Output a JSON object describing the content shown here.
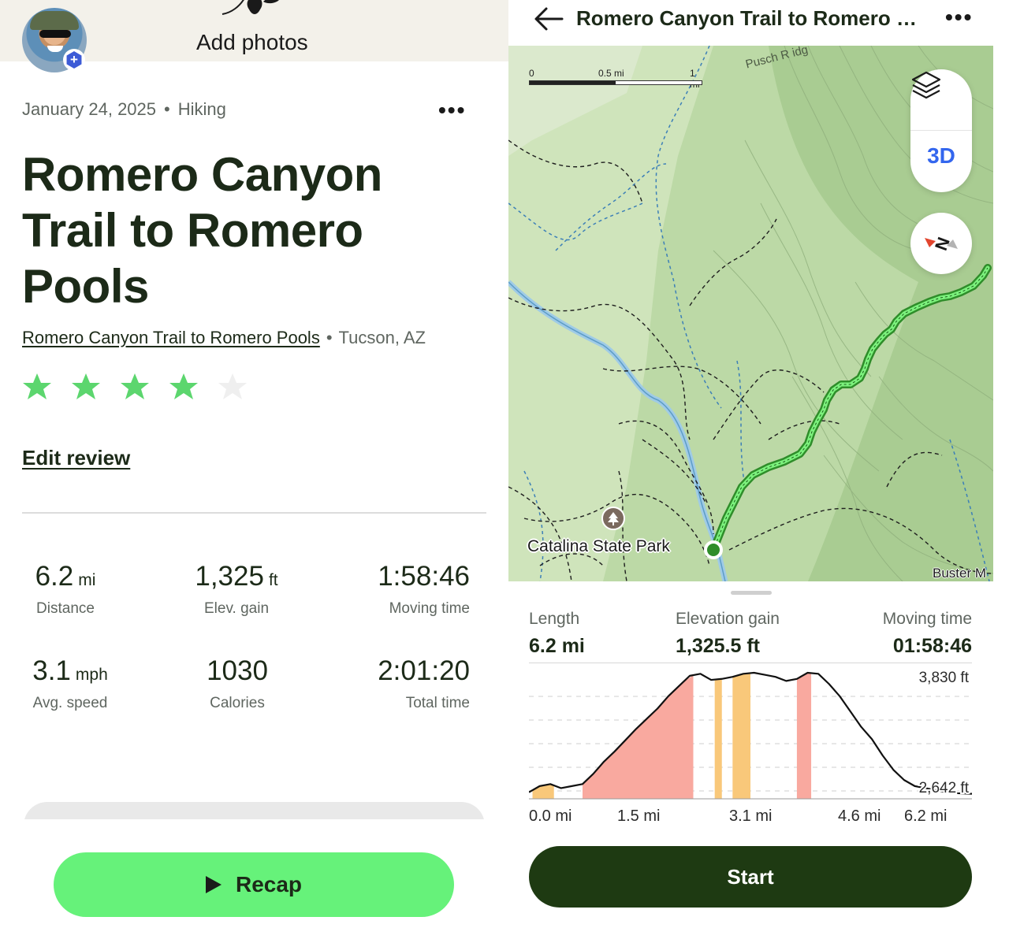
{
  "left": {
    "add_photos_label": "Add photos",
    "activity": {
      "date": "January 24, 2025",
      "separator": "•",
      "type": "Hiking",
      "more_label": "•••"
    },
    "title": "Romero Canyon Trail to Romero Pools",
    "trail": {
      "link_text": "Romero Canyon Trail to Romero Pools",
      "separator": "•",
      "location": "Tucson, AZ"
    },
    "rating": {
      "value": 4,
      "max": 5
    },
    "edit_review_label": "Edit review",
    "stats": [
      {
        "value": "6.2",
        "unit": "mi",
        "label": "Distance"
      },
      {
        "value": "1,325",
        "unit": "ft",
        "label": "Elev. gain"
      },
      {
        "value": "1:58:46",
        "unit": "",
        "label": "Moving time"
      },
      {
        "value": "3.1",
        "unit": "mph",
        "label": "Avg. speed"
      },
      {
        "value": "1030",
        "unit": "",
        "label": "Calories"
      },
      {
        "value": "2:01:20",
        "unit": "",
        "label": "Total time"
      }
    ],
    "recap_label": "Recap"
  },
  "right": {
    "header": {
      "title": "Romero Canyon Trail to Romero P...",
      "more_label": "•••"
    },
    "map": {
      "scale": {
        "zero": "0",
        "half": "0.5 mi",
        "one": "1 mi"
      },
      "toggle_3d_label": "3D",
      "place_label": "Catalina State Park",
      "corner_label": "Buster M",
      "ridge_label": "Pusch R idg"
    },
    "summary": {
      "length_label": "Length",
      "length_value": "6.2 mi",
      "gain_label": "Elevation gain",
      "gain_value": "1,325.5 ft",
      "moving_label": "Moving time",
      "moving_value": "01:58:46"
    },
    "start_label": "Start"
  },
  "colors": {
    "accent_green": "#66f27a",
    "dark_green": "#1e3a12",
    "star_filled": "#5cd66e",
    "star_empty": "#efefef",
    "steep_red": "#f9a99f",
    "moderate_orange": "#f9c87a",
    "map_blue_3d": "#3366ee"
  },
  "icons": [
    "back-arrow-icon",
    "more-icon",
    "layers-icon",
    "compass-icon",
    "park-icon",
    "play-icon",
    "star-icon",
    "add-photo-icon"
  ],
  "chart_data": {
    "type": "area",
    "title": "",
    "xlabel": "",
    "ylabel": "",
    "x_ticks": [
      "0.0 mi",
      "1.5 mi",
      "3.1 mi",
      "4.6 mi",
      "6.2 mi"
    ],
    "y_ticks": [
      "3,830 ft",
      "2,642 ft"
    ],
    "xlim": [
      0,
      6.2
    ],
    "ylim": [
      2642,
      3830
    ],
    "grid": true,
    "series": [
      {
        "x": [
          0.0,
          0.15,
          0.3,
          0.45,
          0.6,
          0.75,
          0.9,
          1.05,
          1.2,
          1.35,
          1.5,
          1.65,
          1.8,
          1.95,
          2.1,
          2.25,
          2.4,
          2.55,
          2.7,
          2.85,
          3.0,
          3.15,
          3.3,
          3.45,
          3.6,
          3.75,
          3.9,
          4.05,
          4.2,
          4.35,
          4.5,
          4.65,
          4.8,
          4.95,
          5.1,
          5.25,
          5.4,
          5.55,
          5.7,
          5.85,
          6.0,
          6.2
        ],
        "values": [
          2660,
          2720,
          2740,
          2700,
          2720,
          2740,
          2840,
          2960,
          3060,
          3170,
          3280,
          3380,
          3480,
          3600,
          3700,
          3800,
          3820,
          3760,
          3770,
          3790,
          3820,
          3830,
          3810,
          3790,
          3750,
          3770,
          3830,
          3820,
          3720,
          3600,
          3450,
          3300,
          3180,
          3020,
          2880,
          2780,
          2720,
          2700,
          2680,
          2660,
          2650,
          2645
        ]
      }
    ],
    "highlight_bands": [
      {
        "from": 0.05,
        "to": 0.35,
        "grade": "moderate"
      },
      {
        "from": 0.75,
        "to": 2.3,
        "grade": "steep"
      },
      {
        "from": 2.6,
        "to": 2.7,
        "grade": "moderate"
      },
      {
        "from": 2.85,
        "to": 3.1,
        "grade": "moderate"
      },
      {
        "from": 3.75,
        "to": 3.95,
        "grade": "steep"
      }
    ]
  }
}
